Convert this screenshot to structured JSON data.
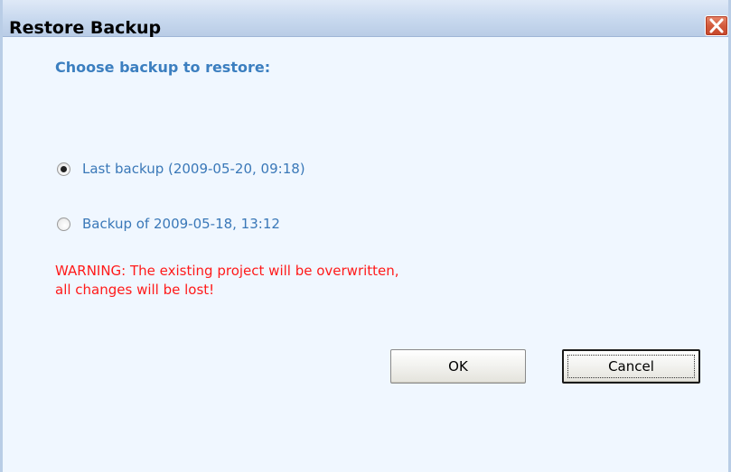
{
  "window": {
    "title": "Restore Backup",
    "close_icon": "close-icon"
  },
  "dialog": {
    "heading": "Choose backup to restore:",
    "options": [
      {
        "label": "Last backup (2009-05-20, 09:18)",
        "selected": true
      },
      {
        "label": "Backup of 2009-05-18, 13:12",
        "selected": false
      }
    ],
    "warning_line1": "WARNING: The existing project will be overwritten,",
    "warning_line2": "all changes will be lost!"
  },
  "buttons": {
    "ok_label": "OK",
    "cancel_label": "Cancel",
    "default_focus": "cancel"
  },
  "colors": {
    "heading": "#3c7fc0",
    "option_text": "#3a78b8",
    "warning": "#ff1a1a",
    "close_button": "#d35b3c"
  }
}
